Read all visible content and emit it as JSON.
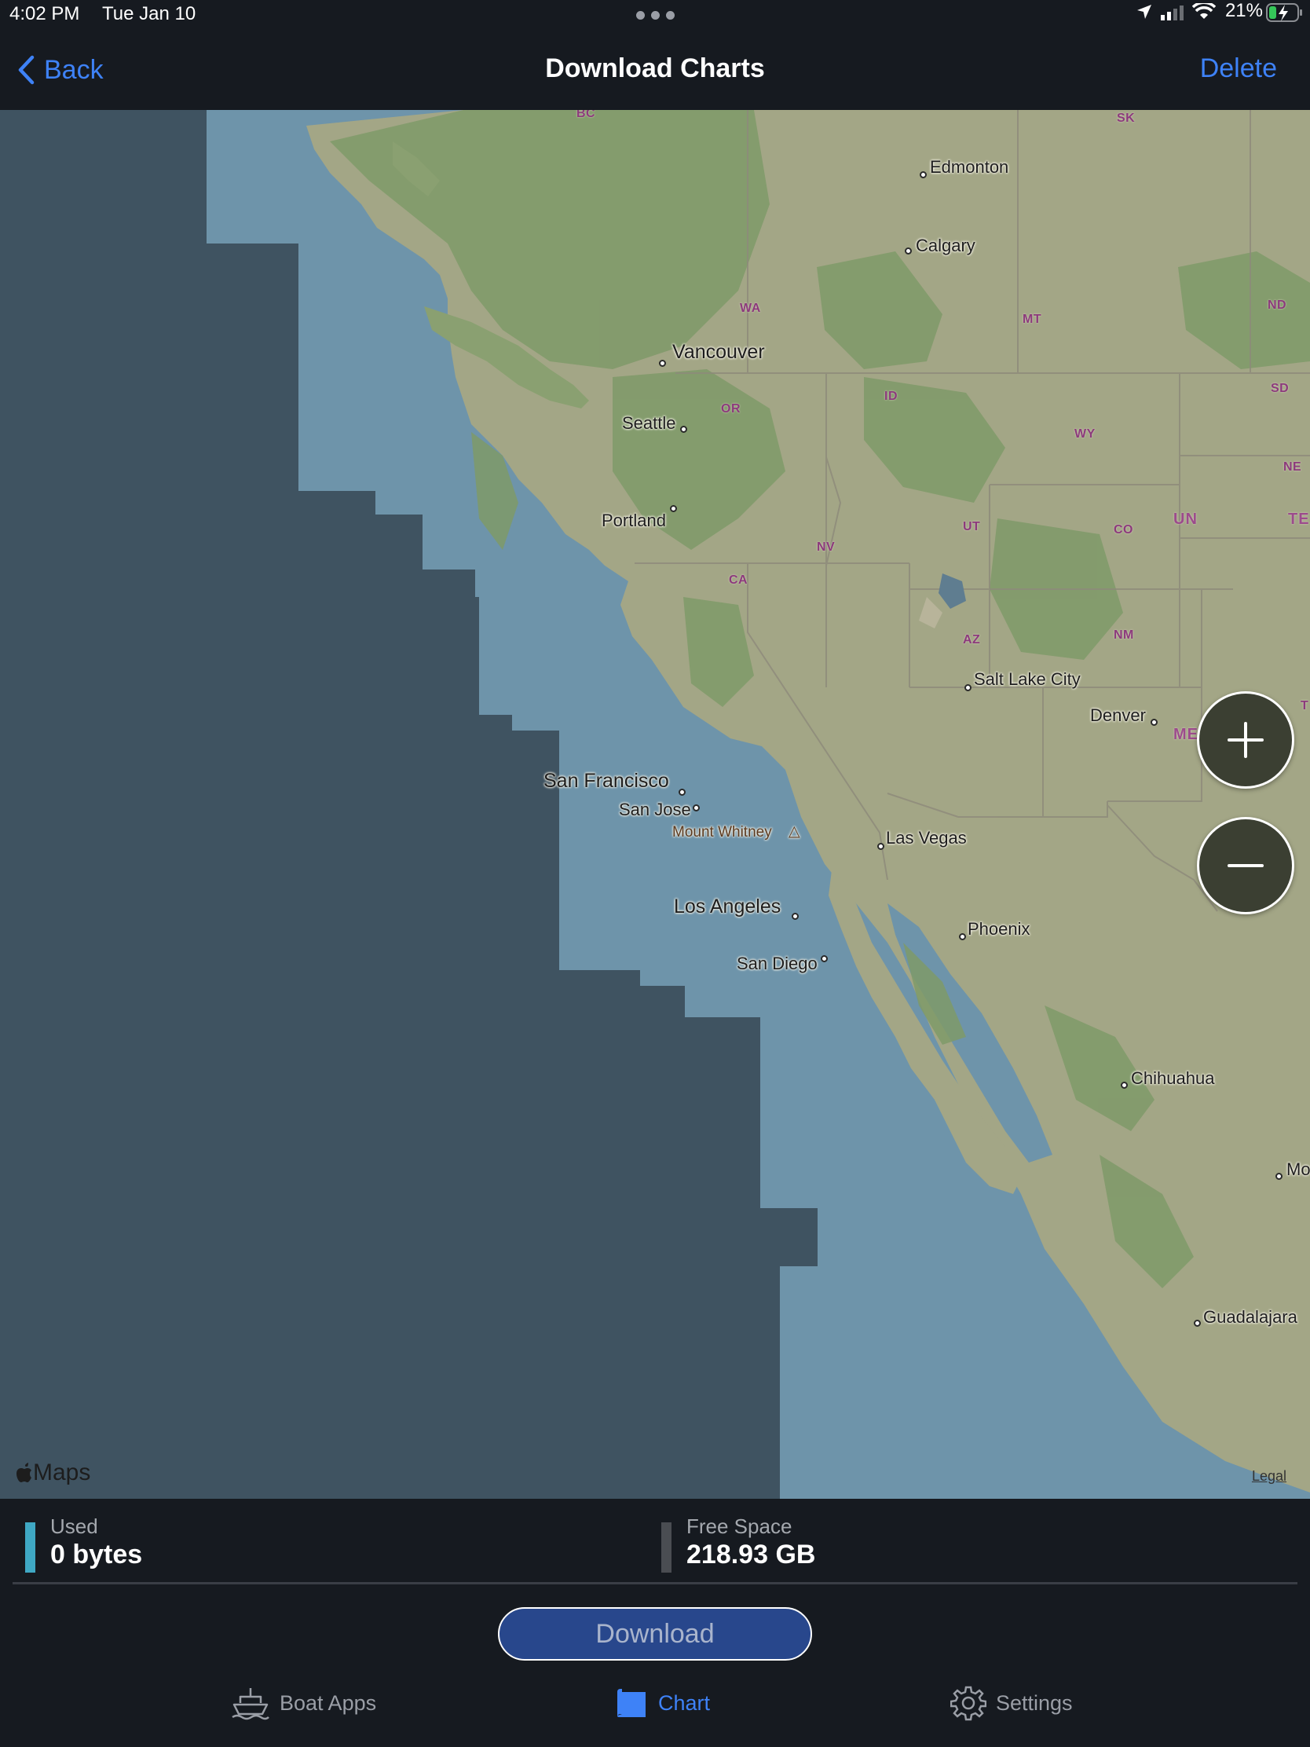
{
  "status_bar": {
    "time": "4:02 PM",
    "date": "Tue Jan 10",
    "battery": "21%"
  },
  "nav": {
    "back_label": "Back",
    "title": "Download Charts",
    "delete_label": "Delete"
  },
  "map": {
    "cities": {
      "edmonton": "Edmonton",
      "calgary": "Calgary",
      "vancouver": "Vancouver",
      "seattle": "Seattle",
      "portland": "Portland",
      "salt_lake_city": "Salt Lake City",
      "denver": "Denver",
      "san_francisco": "San Francisco",
      "san_jose": "San Jose",
      "mount_whitney": "Mount Whitney",
      "las_vegas": "Las Vegas",
      "los_angeles": "Los Angeles",
      "san_diego": "San Diego",
      "phoenix": "Phoenix",
      "chihuahua": "Chihuahua",
      "guadalajara": "Guadalajara",
      "mo": "Mo"
    },
    "regions": {
      "bc": "BC",
      "sk": "SK",
      "wa": "WA",
      "mt": "MT",
      "nd": "ND",
      "sd": "SD",
      "id": "ID",
      "or": "OR",
      "wy": "WY",
      "ne": "NE",
      "ut": "UT",
      "co": "CO",
      "nv": "NV",
      "ca": "CA",
      "az": "AZ",
      "nm": "NM",
      "t": "T",
      "un": "UN",
      "te": "TE",
      "mexico": "MEXICO"
    },
    "maps_logo": "Maps",
    "legal": "Legal",
    "zoom_in_icon": "plus-icon",
    "zoom_out_icon": "minus-icon"
  },
  "storage": {
    "used_label": "Used",
    "used_value": "0 bytes",
    "used_color": "#3fa8c4",
    "free_label": "Free Space",
    "free_value": "218.93 GB",
    "free_color": "#4a4d52"
  },
  "download_label": "Download",
  "tabs": [
    {
      "label": "Boat Apps",
      "icon": "boat-icon",
      "active": false
    },
    {
      "label": "Chart",
      "icon": "chart-map-icon",
      "active": true
    },
    {
      "label": "Settings",
      "icon": "gear-icon",
      "active": false
    }
  ],
  "colors": {
    "accent": "#3e82f7",
    "background": "#161a20",
    "water": "#6e94aa",
    "selected_region": "#3f5361",
    "land": "#9aa480"
  }
}
